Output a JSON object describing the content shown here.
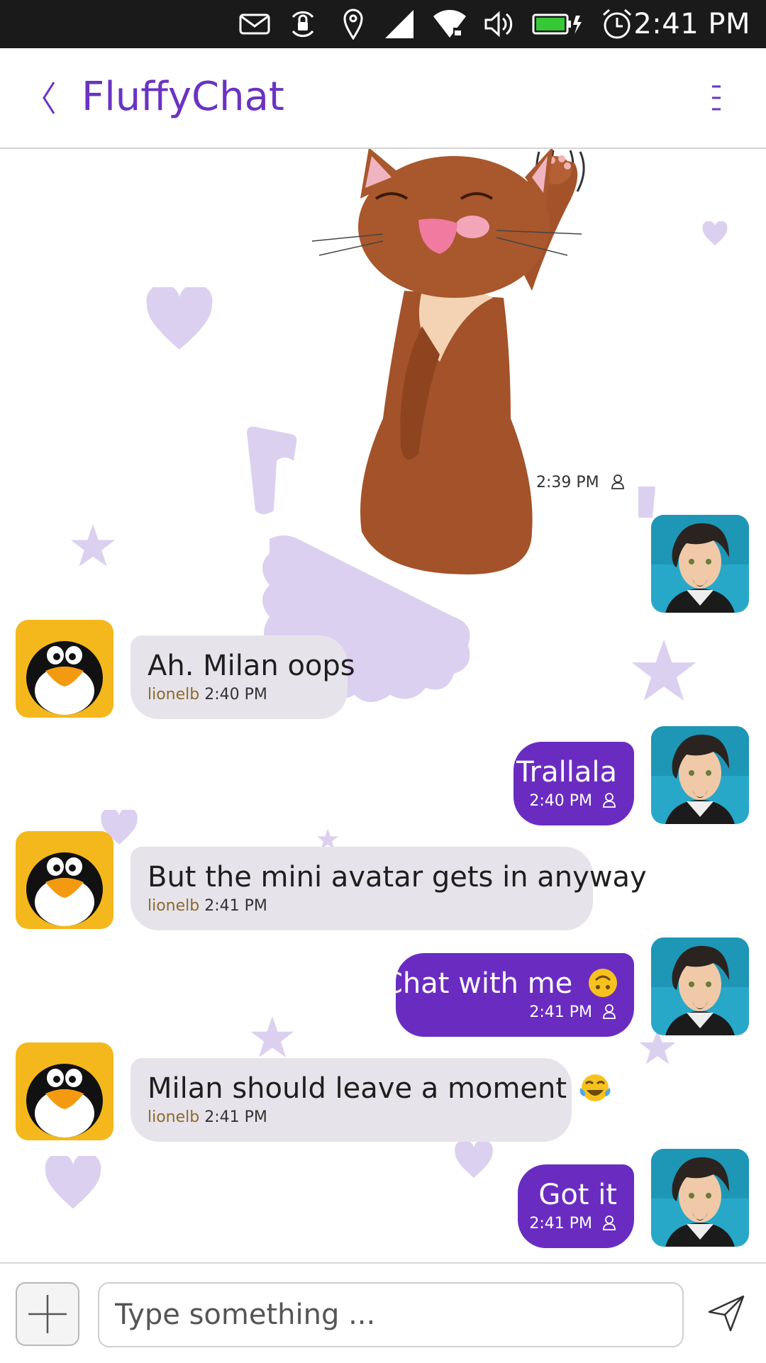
{
  "statusbar": {
    "time": "2:41 PM",
    "icons": [
      "mail-icon",
      "rotation-lock-icon",
      "location-icon",
      "cellular-signal-icon",
      "wifi-icon",
      "volume-icon",
      "battery-charging-icon",
      "alarm-icon"
    ]
  },
  "header": {
    "title": "FluffyChat",
    "back_icon": "chevron-left-icon",
    "menu_icon": "overflow-menu-icon"
  },
  "colors": {
    "accent": "#6a2cc0",
    "incoming_bubble": "#e6e4ea",
    "decoration": "#dcd0f0",
    "sender_name": "#8c6a2e"
  },
  "messages": [
    {
      "type": "sticker",
      "direction": "outgoing",
      "time": "2:39 PM",
      "status_icon": "person-icon"
    },
    {
      "direction": "incoming",
      "text": "Ah. Milan oops",
      "sender": "lionelb",
      "time": "2:40 PM"
    },
    {
      "direction": "outgoing",
      "text": "Trallala",
      "time": "2:40 PM",
      "status_icon": "person-icon"
    },
    {
      "direction": "incoming",
      "text": "But the mini avatar gets in anyway",
      "sender": "lionelb",
      "time": "2:41 PM"
    },
    {
      "direction": "outgoing",
      "text": "Chat with me",
      "emoji": "upside-down-face",
      "time": "2:41 PM",
      "status_icon": "person-icon"
    },
    {
      "direction": "incoming",
      "text": "Milan should leave a moment",
      "emoji": "tears-of-joy",
      "sender": "lionelb",
      "time": "2:41 PM"
    },
    {
      "direction": "outgoing",
      "text": "Got it",
      "time": "2:41 PM",
      "status_icon": "person-icon"
    }
  ],
  "footer": {
    "placeholder": "Type something ...",
    "add_icon": "plus-icon",
    "send_icon": "send-icon"
  }
}
